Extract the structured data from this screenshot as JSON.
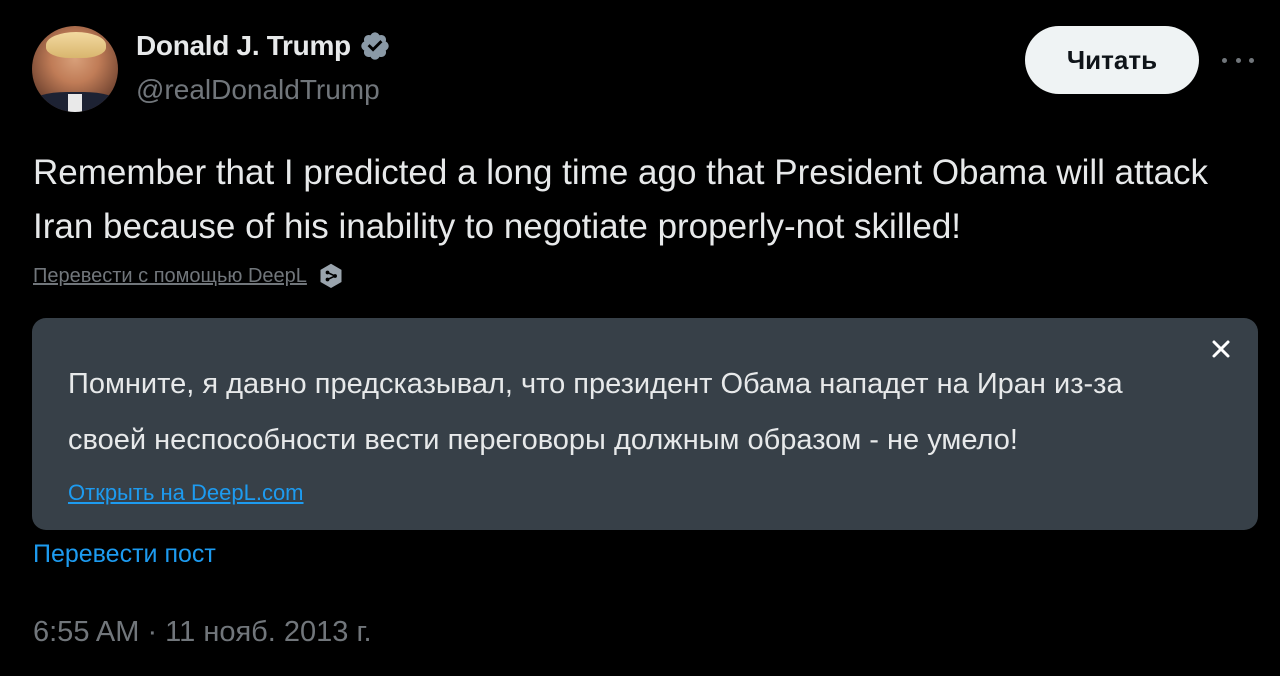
{
  "author": {
    "display_name": "Donald J. Trump",
    "handle": "@realDonaldTrump",
    "verified": true,
    "verified_color": "#7b8a96"
  },
  "header": {
    "follow_label": "Читать",
    "more_icon": "more-horizontal-icon"
  },
  "tweet": {
    "text": "Remember that I predicted a long time ago that President Obama will attack Iran because of his inability to negotiate properly-not skilled!"
  },
  "deepl": {
    "translate_label": "Перевести с помощью DeepL",
    "icon": "deepl-logo-icon"
  },
  "translation": {
    "text": "Помните, я давно предсказывал, что президент Обама нападет на Иран из-за своей неспособности вести переговоры должным образом - не умело!",
    "open_link": "Открыть на DeepL.com",
    "close_icon": "close-icon"
  },
  "actions": {
    "translate_post": "Перевести пост"
  },
  "meta": {
    "timestamp": "6:55 AM · 11 нояб. 2013 г."
  },
  "colors": {
    "background": "#000000",
    "text": "#e7e9ea",
    "secondary": "#71767b",
    "link": "#1d9bf0",
    "translation_bg": "#374048"
  }
}
